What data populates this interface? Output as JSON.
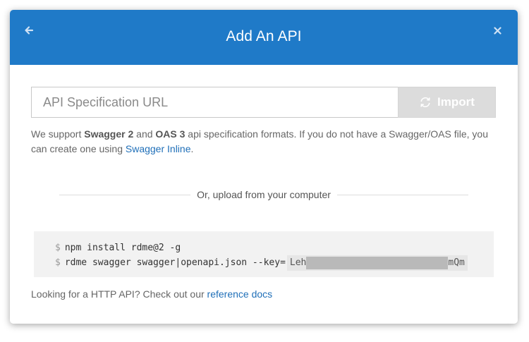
{
  "modal": {
    "title": "Add An API"
  },
  "url_input": {
    "placeholder": "API Specification URL",
    "value": ""
  },
  "import_button": {
    "label": "Import"
  },
  "support": {
    "prefix": "We support ",
    "swagger": "Swagger 2",
    "and": " and ",
    "oas": "OAS 3",
    "middle": " api specification formats. If you do not have a Swagger/OAS file, you can create one using ",
    "link": "Swagger Inline",
    "suffix": "."
  },
  "divider": {
    "label": "Or, upload from your computer"
  },
  "code": {
    "prompt": "$",
    "line1": "npm install rdme@2 -g",
    "line2": "rdme swagger swagger|openapi.json --key=",
    "key_start": "Leh",
    "key_end": "mQm"
  },
  "footer": {
    "text": "Looking for a HTTP API? Check out our ",
    "link": "reference docs"
  },
  "colors": {
    "header_bg": "#1f7ac8",
    "link": "#1f6fb8",
    "import_disabled": "#dcdcdc"
  }
}
